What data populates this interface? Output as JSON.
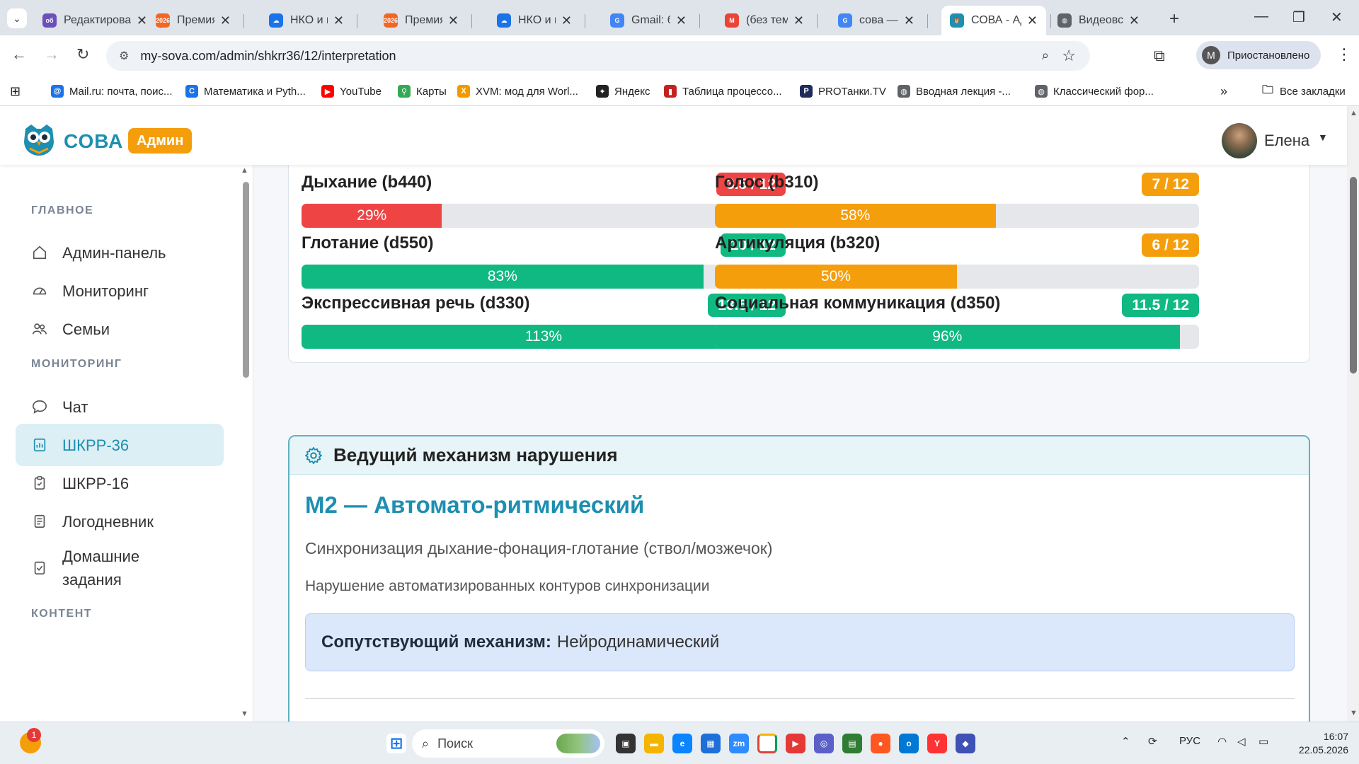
{
  "browser": {
    "tabs": [
      {
        "title": "Редактирование",
        "icon": "vk-icon",
        "color": "#6b4fbb",
        "glyph": "об"
      },
      {
        "title": "Премия #Мы",
        "icon": "premia-icon",
        "color": "#f26522",
        "glyph": "2026"
      },
      {
        "title": "НКО и проекты",
        "icon": "cloud-icon",
        "color": "#1a73e8",
        "glyph": "☁"
      },
      {
        "title": "Премия #Мы",
        "icon": "premia-icon",
        "color": "#f26522",
        "glyph": "2026"
      },
      {
        "title": "НКО и проекты",
        "icon": "cloud-icon",
        "color": "#1a73e8",
        "glyph": "☁"
      },
      {
        "title": "Gmail: без темы",
        "icon": "google-icon",
        "color": "#4285f4",
        "glyph": "G"
      },
      {
        "title": "(без темы)",
        "icon": "gmail-icon",
        "color": "#ea4335",
        "glyph": "M"
      },
      {
        "title": "сова — результаты",
        "icon": "google-icon",
        "color": "#4285f4",
        "glyph": "G"
      },
      {
        "title": "СОВА - Админ",
        "icon": "owl-icon",
        "color": "#1d8fb0",
        "glyph": "🦉"
      },
      {
        "title": "Видеовстреча",
        "icon": "globe-icon",
        "color": "#5f6368",
        "glyph": "◍"
      }
    ],
    "url": "my-sova.com/admin/shkrr36/12/interpretation",
    "profile_initial": "M",
    "profile_label": "Приостановлено",
    "bookmarks": [
      {
        "label": "Mail.ru: почта, поис...",
        "color": "#1a73e8",
        "glyph": "@"
      },
      {
        "label": "Математика и Pyth...",
        "color": "#1a73e8",
        "glyph": "C"
      },
      {
        "label": "YouTube",
        "color": "#ff0000",
        "glyph": "▶"
      },
      {
        "label": "Карты",
        "color": "#34a853",
        "glyph": "⚲"
      },
      {
        "label": "XVM: мод для Worl...",
        "color": "#f29900",
        "glyph": "X"
      },
      {
        "label": "Яндекс",
        "color": "#222222",
        "glyph": "✦"
      },
      {
        "label": "Таблица процессо...",
        "color": "#c5221f",
        "glyph": "▮"
      },
      {
        "label": "PROТанки.TV",
        "color": "#1f2b5c",
        "glyph": "P"
      },
      {
        "label": "Вводная лекция -...",
        "color": "#5f6368",
        "glyph": "◍"
      },
      {
        "label": "Классический фор...",
        "color": "#5f6368",
        "glyph": "◍"
      }
    ],
    "all_bookmarks": "Все закладки"
  },
  "app": {
    "brand": "СОВА",
    "badge": "Админ",
    "user_name": "Елена"
  },
  "sidebar": {
    "sections": [
      "ГЛАВНОЕ",
      "МОНИТОРИНГ",
      "КОНТЕНТ"
    ],
    "items": [
      {
        "label": "Админ-панель",
        "icon": "home-icon"
      },
      {
        "label": "Мониторинг",
        "icon": "gauge-icon"
      },
      {
        "label": "Семьи",
        "icon": "users-icon"
      },
      {
        "label": "Чат",
        "icon": "chat-icon"
      },
      {
        "label": "ШКРР-36",
        "icon": "report-icon",
        "active": true
      },
      {
        "label": "ШКРР-16",
        "icon": "clipboard-icon"
      },
      {
        "label": "Логодневник",
        "icon": "journal-icon"
      },
      {
        "label": "Домашние задания",
        "icon": "task-icon"
      }
    ]
  },
  "metrics": [
    {
      "label": "Дыхание (b440)",
      "score": "3.5 / 12",
      "percent_text": "29%",
      "value": 29,
      "color": "#ef4444"
    },
    {
      "label": "Голос (b310)",
      "score": "7 / 12",
      "percent_text": "58%",
      "value": 58,
      "color": "#f59e0b"
    },
    {
      "label": "Глотание (d550)",
      "score": "10 / 12",
      "percent_text": "83%",
      "value": 83,
      "color": "#10b981"
    },
    {
      "label": "Артикуляция (b320)",
      "score": "6 / 12",
      "percent_text": "50%",
      "value": 50,
      "color": "#f59e0b"
    },
    {
      "label": "Экспрессивная речь (d330)",
      "score": "13.5 / 12",
      "percent_text": "113%",
      "value": 100,
      "color": "#10b981"
    },
    {
      "label": "Социальная коммуникация (d350)",
      "score": "11.5 / 12",
      "percent_text": "96%",
      "value": 96,
      "color": "#10b981"
    }
  ],
  "mechanism": {
    "header": "Ведущий механизм нарушения",
    "title": "M2 — Автомато-ритмический",
    "description": "Синхронизация дыхание-фонация-глотание (ствол/мозжечок)",
    "note": "Нарушение автоматизированных контуров синхронизации",
    "co_label": "Сопутствующий механизм:",
    "co_value": "Нейродинамический"
  },
  "taskbar": {
    "search_placeholder": "Поиск",
    "notification_count": "1",
    "language": "РУС",
    "time": "16:07",
    "date": "22.05.2026"
  }
}
